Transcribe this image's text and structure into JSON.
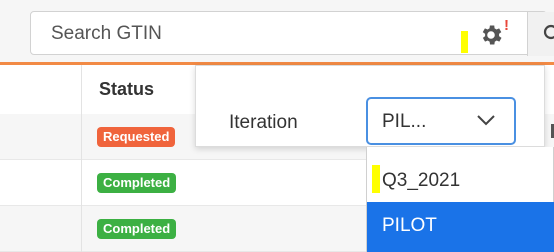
{
  "search": {
    "placeholder": "Search GTIN",
    "alert_mark": "!",
    "highlight_color": "#ffff00",
    "icons": [
      "gear-icon",
      "search-icon"
    ]
  },
  "accent_color": "#f28a45",
  "table": {
    "status_header": "Status",
    "rows": [
      {
        "status": "Requested",
        "color": "#f0643c"
      },
      {
        "status": "Completed",
        "color": "#3cb043"
      },
      {
        "status": "Completed",
        "color": "#3cb043"
      }
    ]
  },
  "popover": {
    "label": "Iteration",
    "selected_display": "PIL...",
    "options": [
      {
        "label": "Q3_2021",
        "selected": false
      },
      {
        "label": "PILOT",
        "selected": true
      }
    ],
    "select_border_color": "#4a90e2",
    "selected_option_color": "#1a73e8"
  }
}
